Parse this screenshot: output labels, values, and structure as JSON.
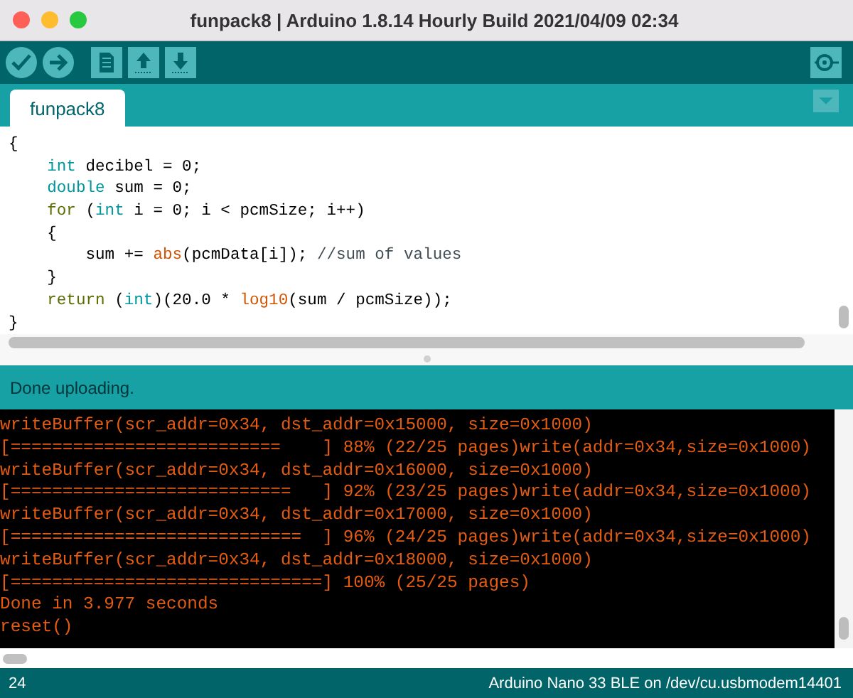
{
  "window": {
    "title": "funpack8 | Arduino 1.8.14 Hourly Build 2021/04/09 02:34"
  },
  "toolbar": {
    "buttons": [
      {
        "kind": "verify"
      },
      {
        "kind": "upload"
      },
      {
        "kind": "new"
      },
      {
        "kind": "open"
      },
      {
        "kind": "save"
      }
    ],
    "right_button": {
      "kind": "serial"
    }
  },
  "tabs": [
    {
      "label": "funpack8",
      "selected": true
    }
  ],
  "editor": {
    "lines": [
      [
        {
          "kind": "plain",
          "text": "{"
        }
      ],
      [
        {
          "kind": "type",
          "text": "    int"
        },
        {
          "kind": "plain",
          "text": " decibel = 0;"
        }
      ],
      [
        {
          "kind": "type",
          "text": "    double"
        },
        {
          "kind": "plain",
          "text": " sum = 0;"
        }
      ],
      [
        {
          "kind": "control",
          "text": "    for"
        },
        {
          "kind": "plain",
          "text": " ("
        },
        {
          "kind": "type",
          "text": "int"
        },
        {
          "kind": "plain",
          "text": " i = 0; i < pcmSize; i++)"
        }
      ],
      [
        {
          "kind": "plain",
          "text": "    {"
        }
      ],
      [
        {
          "kind": "plain",
          "text": "        sum += "
        },
        {
          "kind": "function",
          "text": "abs"
        },
        {
          "kind": "plain",
          "text": "(pcmData[i]); "
        },
        {
          "kind": "comment",
          "text": "//sum of values"
        }
      ],
      [
        {
          "kind": "plain",
          "text": "    }"
        }
      ],
      [
        {
          "kind": "control",
          "text": "    return"
        },
        {
          "kind": "plain",
          "text": " ("
        },
        {
          "kind": "type",
          "text": "int"
        },
        {
          "kind": "plain",
          "text": ")(20.0 * "
        },
        {
          "kind": "function",
          "text": "log10"
        },
        {
          "kind": "plain",
          "text": "(sum / pcmSize));"
        }
      ],
      [
        {
          "kind": "plain",
          "text": "}"
        }
      ]
    ]
  },
  "message": "Done uploading.",
  "console": {
    "lines": [
      "writeBuffer(scr_addr=0x34, dst_addr=0x15000, size=0x1000)",
      "[==========================    ] 88% (22/25 pages)write(addr=0x34,size=0x1000)",
      "writeBuffer(scr_addr=0x34, dst_addr=0x16000, size=0x1000)",
      "[===========================   ] 92% (23/25 pages)write(addr=0x34,size=0x1000)",
      "writeBuffer(scr_addr=0x34, dst_addr=0x17000, size=0x1000)",
      "[============================  ] 96% (24/25 pages)write(addr=0x34,size=0x1000)",
      "writeBuffer(scr_addr=0x34, dst_addr=0x18000, size=0x1000)",
      "[==============================] 100% (25/25 pages)",
      "Done in 3.977 seconds",
      "reset()"
    ]
  },
  "status_bar": {
    "line": "24",
    "board": "Arduino Nano 33 BLE on /dev/cu.usbmodem14401"
  }
}
